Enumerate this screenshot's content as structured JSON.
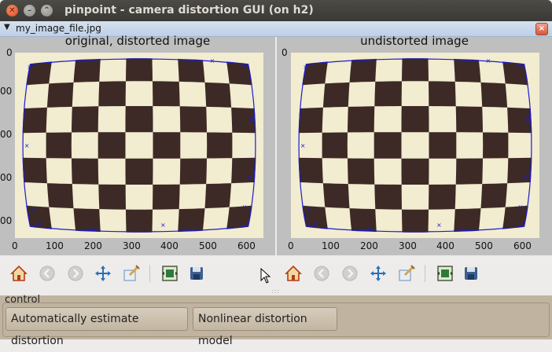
{
  "window": {
    "title": "pinpoint - camera distortion GUI (on h2)"
  },
  "file": {
    "name": "my_image_file.jpg"
  },
  "panels": [
    {
      "title": "original, distorted image",
      "xticks": [
        "0",
        "100",
        "200",
        "300",
        "400",
        "500",
        "600"
      ],
      "yticks": [
        "0",
        "00",
        "00",
        "00",
        "00"
      ]
    },
    {
      "title": "undistorted image",
      "xticks": [
        "0",
        "100",
        "200",
        "300",
        "400",
        "500",
        "600"
      ],
      "yticks": [
        "0",
        "00",
        "00",
        "00",
        "00"
      ]
    }
  ],
  "toolbar": {
    "icons": [
      "home-icon",
      "back-icon",
      "forward-icon",
      "pan-icon",
      "zoom-icon",
      "subplots-icon",
      "save-icon"
    ]
  },
  "control": {
    "legend": "control",
    "auto_label": "Automatically estimate distortion",
    "nonlinear_label": "Nonlinear distortion model"
  },
  "colors": {
    "titlebar": "#3c3b37",
    "filebar": "#c8d7ea",
    "control_bg": "#c0b4a0",
    "marker": "#1a1ad6"
  }
}
